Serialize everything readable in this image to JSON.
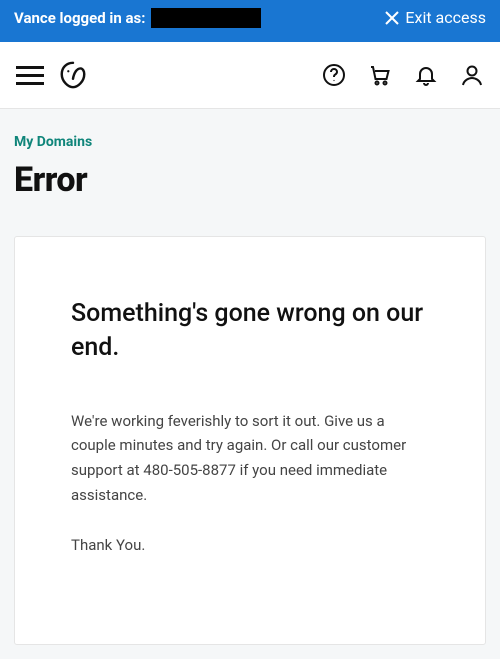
{
  "impersonation": {
    "logged_in_as_prefix": "Vance logged in as:",
    "exit_access_label": "Exit access"
  },
  "breadcrumb": {
    "my_domains": "My Domains"
  },
  "page": {
    "title": "Error"
  },
  "error_card": {
    "heading": "Something's gone wrong on our end.",
    "body": "We're working feverishly to sort it out. Give us a couple minutes and try again. Or call our customer support at 480-505-8877 if you need immediate assistance.",
    "thanks": "Thank You."
  }
}
